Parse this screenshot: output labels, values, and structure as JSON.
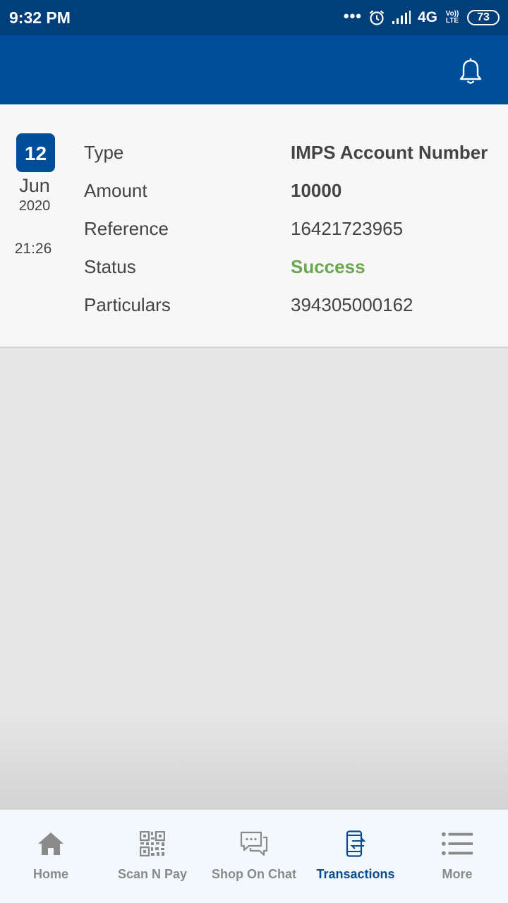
{
  "status_bar": {
    "time": "9:32 PM",
    "dots": "•••",
    "network": "4G",
    "volte": "Vo)) LTE",
    "battery": "73"
  },
  "transaction": {
    "date": {
      "day": "12",
      "month": "Jun",
      "year": "2020",
      "time": "21:26"
    },
    "rows": [
      {
        "label": "Type",
        "value": "IMPS Account Number"
      },
      {
        "label": "Amount",
        "value": "10000"
      },
      {
        "label": "Reference",
        "value": "16421723965"
      },
      {
        "label": "Status",
        "value": "Success"
      },
      {
        "label": "Particulars",
        "value": "394305000162"
      }
    ]
  },
  "nav": {
    "items": [
      {
        "label": "Home",
        "icon": "home-icon"
      },
      {
        "label": "Scan N Pay",
        "icon": "qr-code-icon"
      },
      {
        "label": "Shop On Chat",
        "icon": "chat-icon"
      },
      {
        "label": "Transactions",
        "icon": "transactions-icon",
        "active": true
      },
      {
        "label": "More",
        "icon": "menu-list-icon"
      }
    ]
  },
  "colors": {
    "status_bar": "#003f7a",
    "app_bar": "#004d99",
    "accent": "#004d99",
    "success": "#6aa84f",
    "nav_active": "#0a4c8f",
    "nav_inactive": "#8a8a8a"
  }
}
